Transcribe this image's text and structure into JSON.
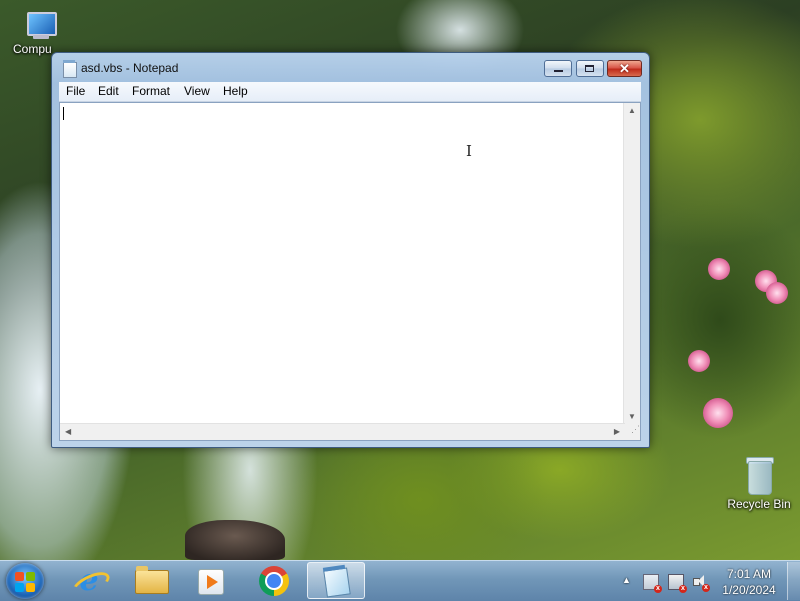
{
  "desktop": {
    "icons": [
      {
        "label": "Compu",
        "icon": "computer-icon"
      },
      {
        "label": "Recycle Bin",
        "icon": "recycle-bin-icon"
      }
    ]
  },
  "window": {
    "title": "asd.vbs - Notepad",
    "app_icon": "notepad-icon",
    "controls": {
      "minimize": "minimize-icon",
      "maximize": "maximize-icon",
      "close": "close-icon",
      "close_glyph": "✕"
    },
    "menu": [
      "File",
      "Edit",
      "Format",
      "View",
      "Help"
    ],
    "content": ""
  },
  "taskbar": {
    "start": "windows-start-icon",
    "apps": [
      {
        "name": "Internet Explorer",
        "icon": "internet-explorer-icon"
      },
      {
        "name": "Windows Explorer",
        "icon": "folder-icon"
      },
      {
        "name": "Windows Media Player",
        "icon": "media-player-icon"
      },
      {
        "name": "Google Chrome",
        "icon": "chrome-icon"
      },
      {
        "name": "Notepad",
        "icon": "notepad-icon",
        "active": true
      }
    ],
    "tray": {
      "overflow_glyph": "▲",
      "icons": [
        "action-center-flag-icon",
        "network-icon",
        "volume-icon"
      ],
      "time": "7:01 AM",
      "date": "1/20/2024"
    }
  },
  "colors": {
    "close_button": "#c8372a",
    "taskbar": "#6b93b8",
    "window_frame": "#a6c4e5"
  }
}
